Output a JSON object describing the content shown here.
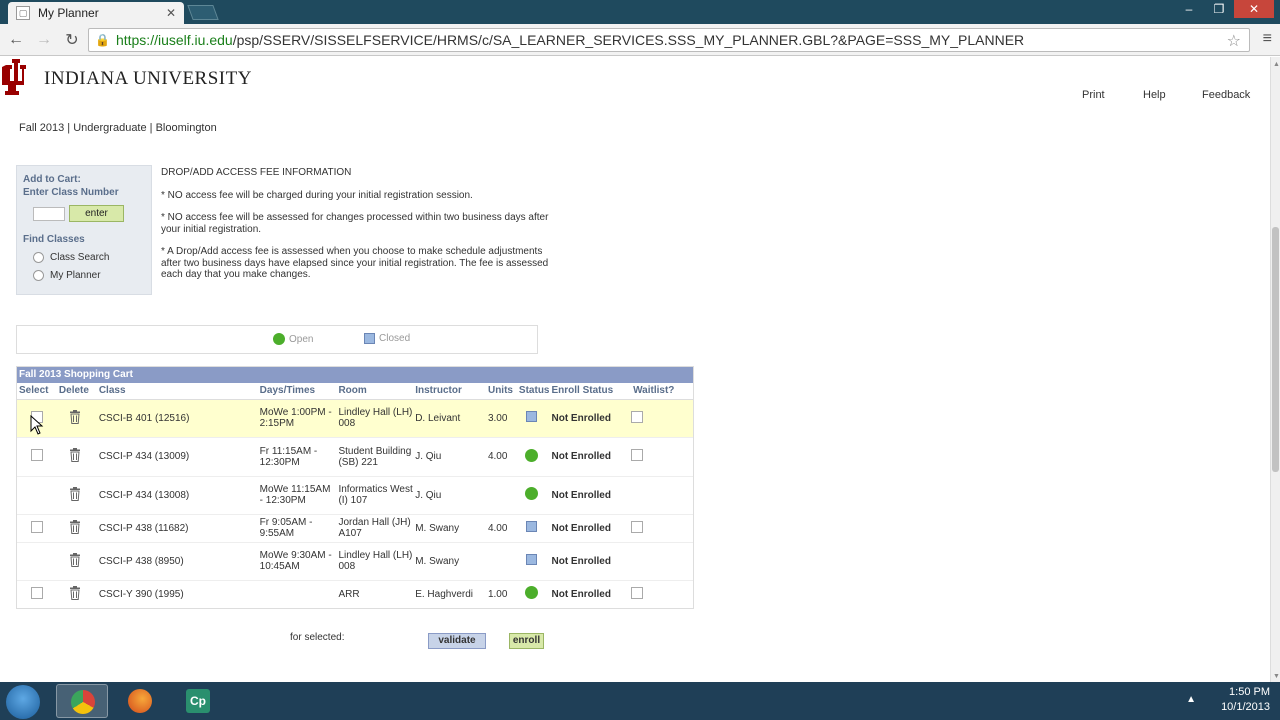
{
  "browser": {
    "tab_title": "My Planner",
    "tab_close": "✕",
    "url_host": "https://iuself.iu.edu",
    "url_path": "/psp/SSERV/SISSELFSERVICE/HRMS/c/SA_LEARNER_SERVICES.SSS_MY_PLANNER.GBL?&PAGE=SSS_MY_PLANNER",
    "win_min": "‒",
    "win_max": "❐",
    "win_close": "✕"
  },
  "header": {
    "university": "INDIANA UNIVERSITY",
    "links": {
      "print": "Print",
      "help": "Help",
      "feedback": "Feedback"
    },
    "term_line": "Fall 2013 | Undergraduate | Bloomington"
  },
  "add_to_cart": {
    "title": "Add to Cart:",
    "class_number_label": "Enter Class Number",
    "class_number_value": "",
    "enter_label": "enter",
    "find_classes_label": "Find Classes",
    "options": [
      "Class Search",
      "My Planner"
    ]
  },
  "fee_info": {
    "heading": "DROP/ADD ACCESS FEE INFORMATION",
    "lines": [
      "* NO access fee will be charged during your initial registration session.",
      "* NO access fee will be assessed for changes processed within two business days after your initial registration.",
      "* A Drop/Add access fee is assessed when you choose to make schedule adjustments after two business days have elapsed since your initial registration. The fee is assessed each day that you make changes."
    ]
  },
  "legend": {
    "open": "Open",
    "closed": "Closed"
  },
  "cart": {
    "caption": "Fall 2013 Shopping Cart",
    "columns": [
      "Select",
      "Delete",
      "Class",
      "Days/Times",
      "Room",
      "Instructor",
      "Units",
      "Status",
      "Enroll Status",
      "Waitlist?"
    ],
    "rows": [
      {
        "class": "CSCI-B 401 (12516)",
        "days": "MoWe 1:00PM - 2:15PM",
        "room": "Lindley Hall (LH) 008",
        "instructor": "D. Leivant",
        "units": "3.00",
        "status": "closed",
        "enroll": "Not Enrolled",
        "selectable": true,
        "waitlist": true
      },
      {
        "class": "CSCI-P 434 (13009)",
        "days": "Fr 11:15AM - 12:30PM",
        "room": "Student Building (SB) 221",
        "instructor": "J. Qiu",
        "units": "4.00",
        "status": "open",
        "enroll": "Not Enrolled",
        "selectable": true,
        "waitlist": true
      },
      {
        "class": "CSCI-P 434 (13008)",
        "days": "MoWe 11:15AM - 12:30PM",
        "room": "Informatics West (I) 107",
        "instructor": "J. Qiu",
        "units": "",
        "status": "open",
        "enroll": "Not Enrolled",
        "selectable": false,
        "waitlist": false
      },
      {
        "class": "CSCI-P 438 (11682)",
        "days": "Fr 9:05AM - 9:55AM",
        "room": "Jordan Hall (JH) A107",
        "instructor": "M. Swany",
        "units": "4.00",
        "status": "closed",
        "enroll": "Not Enrolled",
        "selectable": true,
        "waitlist": true
      },
      {
        "class": "CSCI-P 438 (8950)",
        "days": "MoWe 9:30AM - 10:45AM",
        "room": "Lindley Hall (LH) 008",
        "instructor": "M. Swany",
        "units": "",
        "status": "closed",
        "enroll": "Not Enrolled",
        "selectable": false,
        "waitlist": false
      },
      {
        "class": "CSCI-Y 390 (1995)",
        "days": "",
        "room": "ARR",
        "instructor": "E. Haghverdi",
        "units": "1.00",
        "status": "open",
        "enroll": "Not Enrolled",
        "selectable": true,
        "waitlist": true
      }
    ]
  },
  "actions": {
    "for_selected": "for selected:",
    "validate": "validate",
    "enroll": "enroll"
  },
  "taskbar": {
    "time": "1:50 PM",
    "date": "10/1/2013",
    "cp_label": "Cp"
  },
  "colors": {
    "open": "#4cae2b",
    "closed": "#9bb8e0",
    "caption": "#8a9bc6",
    "enter": "#d8e9a9",
    "iu_crimson": "#990000"
  }
}
